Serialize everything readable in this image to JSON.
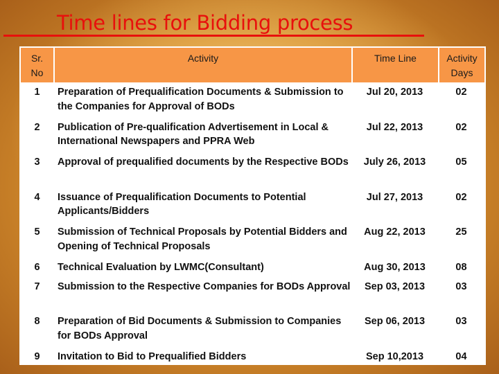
{
  "title": "Time lines for Bidding process",
  "colors": {
    "title": "#e8100c",
    "header_bg": "#f79646",
    "table_bg": "#ffffff"
  },
  "table": {
    "headers": {
      "sr_no": "Sr. No",
      "activity": "Activity",
      "time_line": "Time Line",
      "activity_days": "Activity Days"
    },
    "rows": [
      {
        "sr": "1",
        "activity": "Preparation of Prequalification Documents & Submission to the Companies for Approval of BODs",
        "time_line": "Jul 20, 2013",
        "days": "02"
      },
      {
        "sr": "2",
        "activity": "Publication of Pre-qualification Advertisement  in Local & International Newspapers and PPRA Web",
        "time_line": "Jul 22, 2013",
        "days": "02"
      },
      {
        "sr": "3",
        "activity": "Approval of prequalified documents  by the Respective BODs",
        "time_line": "July 26, 2013",
        "days": "05"
      },
      {
        "sr": "4",
        "activity": "Issuance of Prequalification Documents to Potential Applicants/Bidders",
        "time_line": "Jul 27, 2013",
        "days": "02"
      },
      {
        "sr": "5",
        "activity": "Submission of Technical Proposals by Potential Bidders and Opening of Technical Proposals",
        "time_line": "Aug 22, 2013",
        "days": "25"
      },
      {
        "sr": "6",
        "activity": "Technical Evaluation by LWMC(Consultant)",
        "time_line": "Aug 30, 2013",
        "days": "08"
      },
      {
        "sr": "7",
        "activity": "Submission to the Respective Companies for BODs Approval",
        "time_line": "Sep 03, 2013",
        "days": "03"
      },
      {
        "sr": "8",
        "activity": "Preparation of Bid Documents & Submission to Companies for BODs  Approval",
        "time_line": "Sep 06, 2013",
        "days": "03"
      },
      {
        "sr": "9",
        "activity": "Invitation to Bid to Prequalified Bidders",
        "time_line": "Sep 10,2013",
        "days": "04"
      }
    ]
  }
}
